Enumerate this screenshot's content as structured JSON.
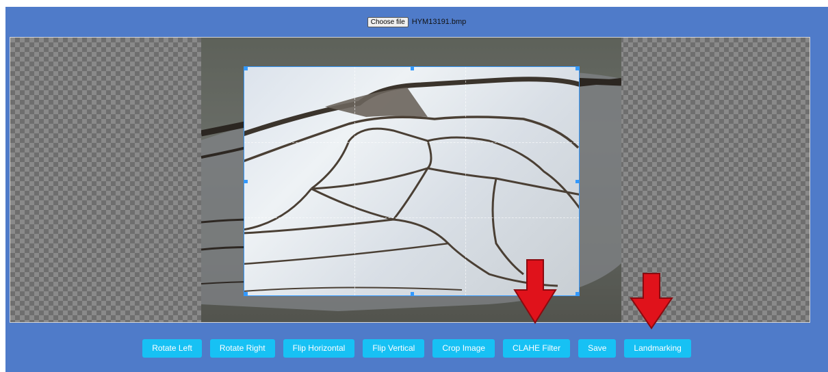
{
  "file_input": {
    "button_label": "Choose file",
    "file_name": "HYM13191.bmp"
  },
  "toolbar": {
    "buttons": [
      {
        "id": "rotate-left",
        "label": "Rotate Left"
      },
      {
        "id": "rotate-right",
        "label": "Rotate Right"
      },
      {
        "id": "flip-horizontal",
        "label": "Flip Horizontal"
      },
      {
        "id": "flip-vertical",
        "label": "Flip Vertical"
      },
      {
        "id": "crop-image",
        "label": "Crop Image"
      },
      {
        "id": "clahe-filter",
        "label": "CLAHE Filter"
      },
      {
        "id": "save",
        "label": "Save"
      },
      {
        "id": "landmarking",
        "label": "Landmarking"
      }
    ]
  },
  "annotations": {
    "arrow_color": "#e0121b",
    "arrow_targets": [
      "CLAHE Filter",
      "Landmarking"
    ]
  },
  "colors": {
    "background": "#4f7bc9",
    "button": "#17c1f4",
    "crop_border": "#3399ff"
  }
}
